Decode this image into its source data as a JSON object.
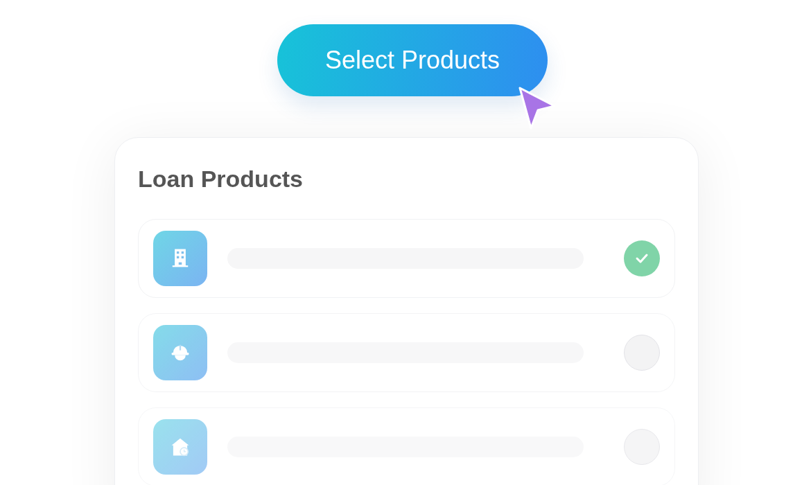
{
  "action_button": {
    "label": "Select Products"
  },
  "card": {
    "title": "Loan Products",
    "items": [
      {
        "kind": "building",
        "checked": true
      },
      {
        "kind": "helmet",
        "checked": false
      },
      {
        "kind": "house",
        "checked": false
      }
    ]
  }
}
